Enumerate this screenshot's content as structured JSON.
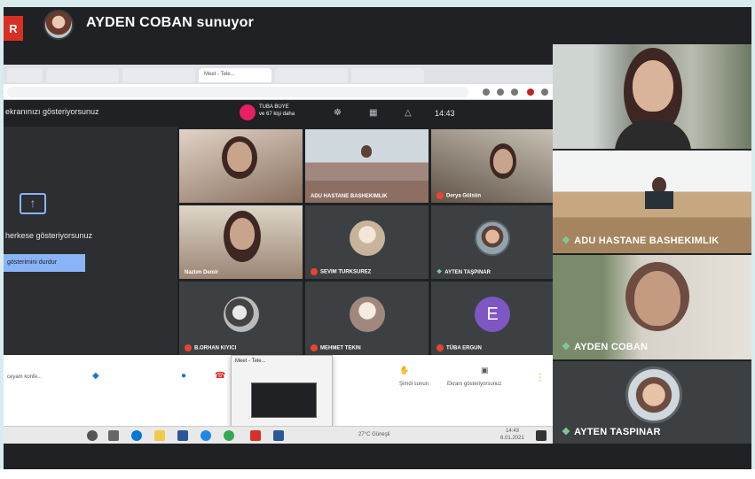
{
  "presenter": {
    "badge": "R",
    "title": "AYDEN COBAN sunuyor"
  },
  "browser": {
    "tabs": [
      "",
      "",
      "",
      "Meet - Tele...",
      "",
      ""
    ],
    "address": ""
  },
  "inner_meet": {
    "notice": "ekranınızı gösteriyorsunuz",
    "presenter_line1": "TUBA BUYE",
    "presenter_line2": "ve 67 kişi daha",
    "time": "14:43",
    "share_text": "herkese gösteriyorsunuz",
    "share_button": "gösterimini durdur"
  },
  "inner_tiles": [
    {
      "name": ""
    },
    {
      "name": "ADU HASTANE BASHEKIMLIK"
    },
    {
      "name": "Derya Gülsün"
    },
    {
      "name": "Nazlım Demir"
    },
    {
      "name": "SEVIM TURKSUREZ"
    },
    {
      "name": "AYTEN TAŞPINAR"
    },
    {
      "name": "B.ORHAN KIYICI"
    },
    {
      "name": "MEHMET TEKIN"
    },
    {
      "name": "TÜBA ERGUN"
    }
  ],
  "inner_letter_avatar": "E",
  "taskbar": {
    "popup_title": "Meet - Tele...",
    "tray_text": "27°C Güneşli",
    "clock_time": "14:43",
    "clock_date": "6.01.2021",
    "left_label": "ceyam konfe...",
    "present_label": "Şimdi sunun",
    "share_label": "Ekranı gösteriyorsunuz"
  },
  "sidebar": [
    {
      "name": "",
      "speaking": false
    },
    {
      "name": "ADU HASTANE BASHEKIMLIK",
      "speaking": true
    },
    {
      "name": "AYDEN COBAN",
      "speaking": true
    },
    {
      "name": "AYTEN TASPINAR",
      "speaking": true
    }
  ],
  "colors": {
    "meet_bg": "#202124",
    "tile_bg": "#3c4043",
    "accent_blue": "#8ab4f8",
    "record_red": "#d93025",
    "speaking_green": "#81c995",
    "letter_avatar": "#7e57c2"
  }
}
